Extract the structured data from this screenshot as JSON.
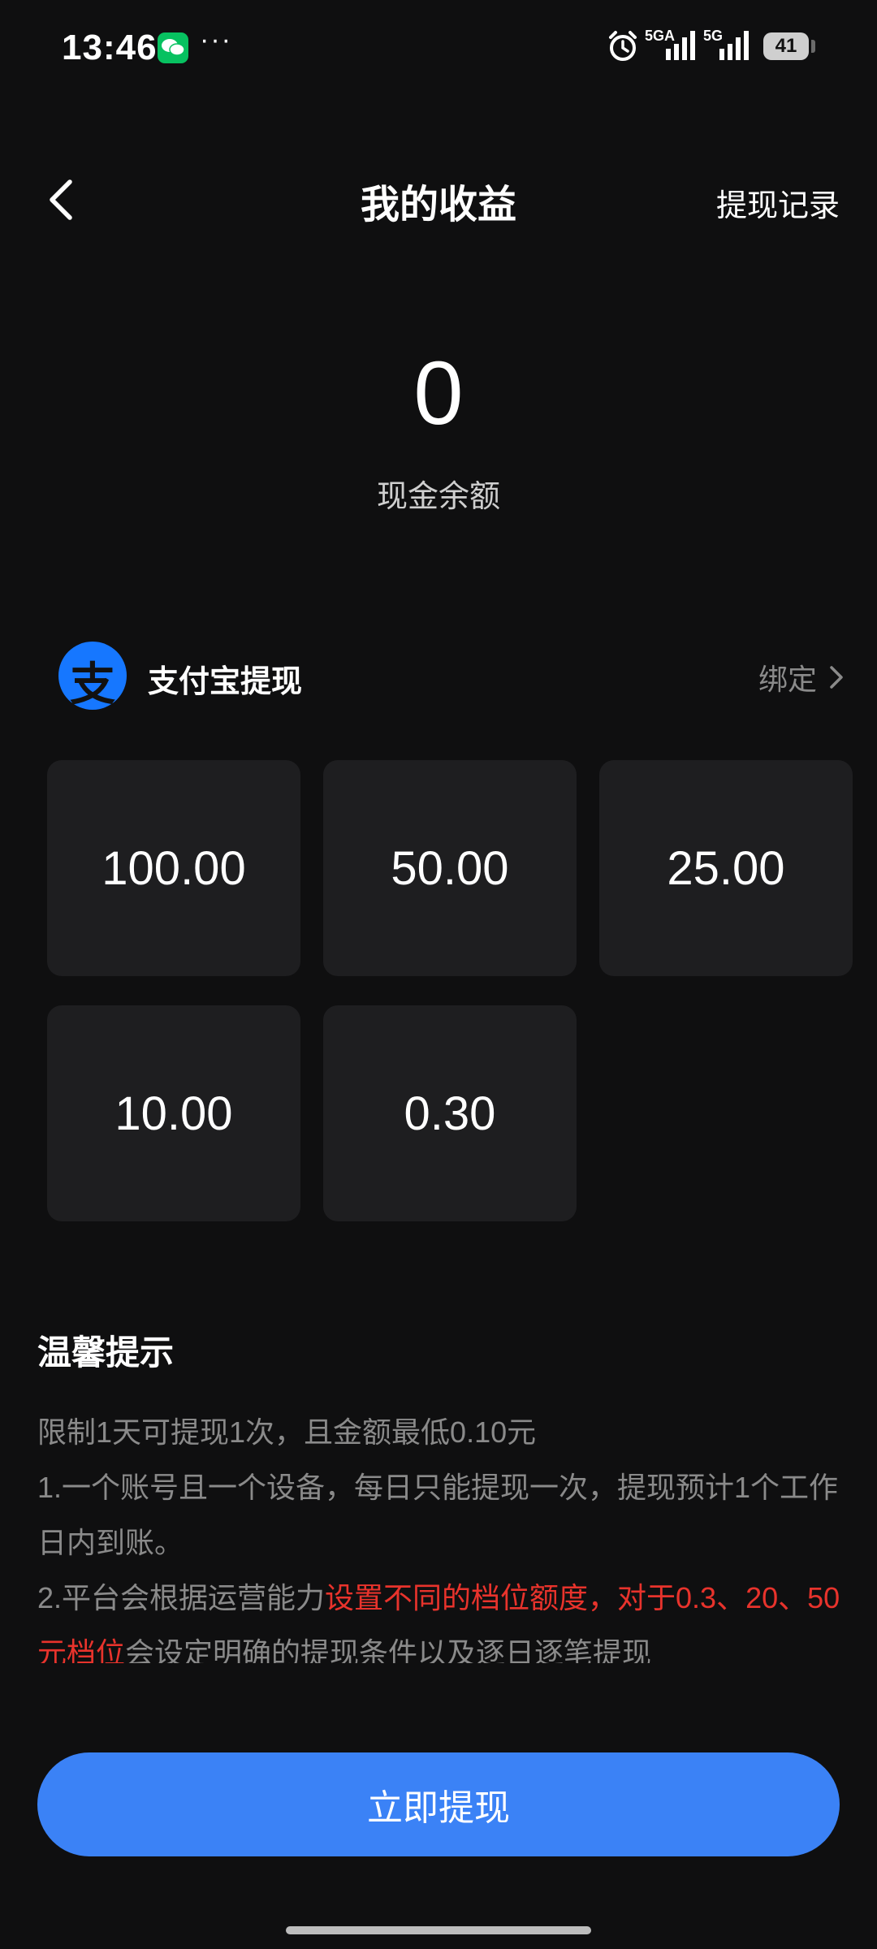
{
  "status_bar": {
    "time": "13:46",
    "dots": "···",
    "network1": "5GA",
    "network2": "5G",
    "battery": "41"
  },
  "header": {
    "title": "我的收益",
    "history_link": "提现记录"
  },
  "balance": {
    "value": "0",
    "label": "现金余额"
  },
  "alipay": {
    "logo_glyph": "支",
    "title": "支付宝提现",
    "bind_label": "绑定"
  },
  "amounts": [
    "100.00",
    "50.00",
    "25.00",
    "10.00",
    "0.30"
  ],
  "tips": {
    "title": "温馨提示",
    "line1": "限制1天可提现1次，且金额最低0.10元",
    "line2": "1.一个账号且一个设备，每日只能提现一次，提现预计1个工作日内到账。",
    "line3_prefix": "2.平台会根据运营能力",
    "line3_highlight": "设置不同的档位额度，对于0.3、20、50元档位",
    "line3_suffix": "会设定明确的提现条件以及逐日逐笔提现"
  },
  "withdraw_button": "立即提现",
  "colors": {
    "background": "#0f0f10",
    "card": "#1e1e20",
    "accent_blue": "#3b82f6",
    "alipay_blue": "#1677ff",
    "highlight_red": "#e8332c"
  }
}
